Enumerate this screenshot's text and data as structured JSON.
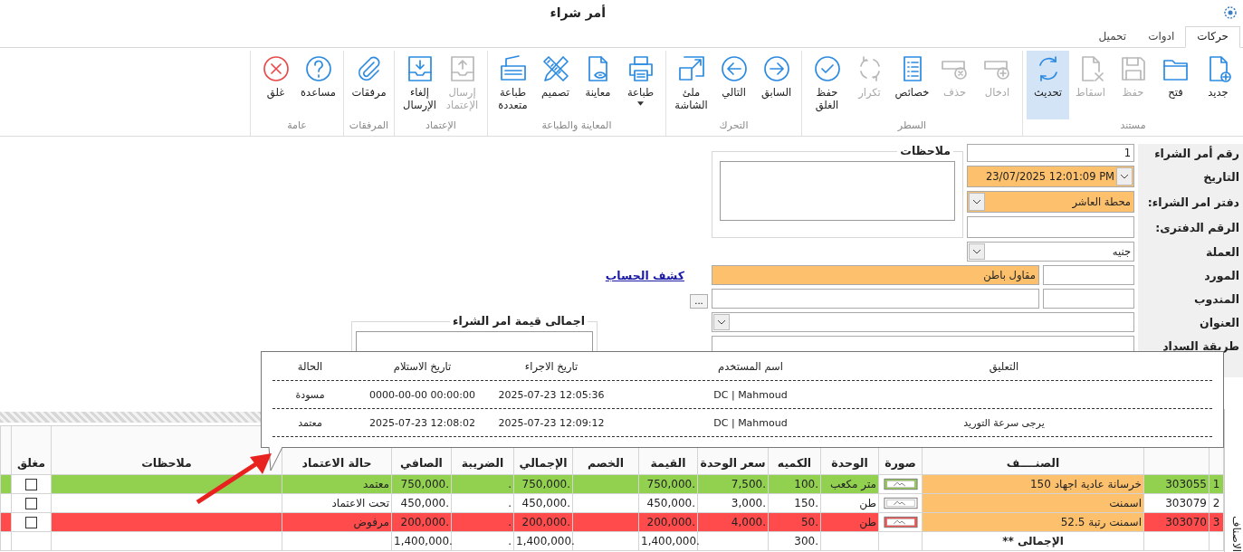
{
  "window": {
    "title": "أمر شراء"
  },
  "tabs": [
    {
      "label": "حركات",
      "selected": true
    },
    {
      "label": "ادوات",
      "selected": false
    },
    {
      "label": "تحميل",
      "selected": false
    }
  ],
  "ribbon": [
    {
      "label": "مستند",
      "buttons": [
        {
          "label": "جديد",
          "disabled": false,
          "highlighted": false,
          "dropdown": false
        },
        {
          "label": "فتح",
          "disabled": false,
          "highlighted": false,
          "dropdown": false
        },
        {
          "label": "حفظ",
          "disabled": true,
          "highlighted": false,
          "dropdown": false
        },
        {
          "label": "اسقاط",
          "disabled": true,
          "highlighted": false,
          "dropdown": false
        },
        {
          "label": "تحديث",
          "disabled": false,
          "highlighted": true,
          "dropdown": false
        }
      ]
    },
    {
      "label": "السطر",
      "buttons": [
        {
          "label": "ادخال",
          "disabled": true,
          "highlighted": false,
          "dropdown": false
        },
        {
          "label": "حذف",
          "disabled": true,
          "highlighted": false,
          "dropdown": false
        },
        {
          "label": "خصائص",
          "disabled": false,
          "highlighted": false,
          "dropdown": false
        },
        {
          "label": "تكرار",
          "disabled": true,
          "highlighted": false,
          "dropdown": false
        },
        {
          "label": "حفظ الغلق",
          "disabled": false,
          "highlighted": false,
          "dropdown": false
        }
      ]
    },
    {
      "label": "التحرك",
      "buttons": [
        {
          "label": "السابق",
          "disabled": false,
          "highlighted": false,
          "dropdown": false
        },
        {
          "label": "التالي",
          "disabled": false,
          "highlighted": false,
          "dropdown": false
        },
        {
          "label": "ملئ الشاشة",
          "disabled": false,
          "highlighted": false,
          "dropdown": false
        }
      ]
    },
    {
      "label": "المعاينة والطباعة",
      "buttons": [
        {
          "label": "طباعة",
          "disabled": false,
          "highlighted": false,
          "dropdown": true
        },
        {
          "label": "معاينة",
          "disabled": false,
          "highlighted": false,
          "dropdown": false
        },
        {
          "label": "تصميم",
          "disabled": false,
          "highlighted": false,
          "dropdown": false
        },
        {
          "label": "طباعة متعددة",
          "disabled": false,
          "highlighted": false,
          "dropdown": false
        }
      ]
    },
    {
      "label": "الإعتماد",
      "buttons": [
        {
          "label": "إرسال الإعتماد",
          "disabled": true,
          "highlighted": false,
          "dropdown": false
        },
        {
          "label": "إلغاء الإرسال",
          "disabled": false,
          "highlighted": false,
          "dropdown": false
        }
      ]
    },
    {
      "label": "المرفقات",
      "buttons": [
        {
          "label": "مرفقات",
          "disabled": false,
          "highlighted": false,
          "dropdown": false
        }
      ]
    },
    {
      "label": "عامة",
      "buttons": [
        {
          "label": "مساعدة",
          "disabled": false,
          "highlighted": false,
          "dropdown": false
        },
        {
          "label": "غلق",
          "disabled": false,
          "highlighted": false,
          "dropdown": false
        }
      ]
    }
  ],
  "form": {
    "fields": [
      {
        "label": "رقم أمر الشراء",
        "kind": "text",
        "value": "1",
        "required": false
      },
      {
        "label": "التاريخ",
        "kind": "date",
        "value": "23/07/2025 12:01:09 PM",
        "required": true
      },
      {
        "label": "دفتر امر الشراء:",
        "kind": "combo",
        "value": "محطة العاشر",
        "required": true
      },
      {
        "label": "الرقم الدفترى:",
        "kind": "text",
        "required": false
      },
      {
        "label": "العملة",
        "kind": "combo",
        "value": "جنيه",
        "required": false
      },
      {
        "label": "المورد",
        "kind": "pair",
        "value": "مقاول باطن",
        "required": true
      },
      {
        "label": "المندوب",
        "kind": "pair",
        "required": false
      },
      {
        "label": "العنوان",
        "kind": "combo",
        "required": false
      },
      {
        "label": "طريقة السداد",
        "kind": "text",
        "required": false
      }
    ],
    "notes": {
      "title": "ملاحظات"
    },
    "account_link": "كشف الحساب",
    "browse_button": "...",
    "totals_group": {
      "title": "اجمالى قيمة امر الشراء"
    }
  },
  "history_popup": {
    "columns": [
      "التعليق",
      "اسم المستخدم",
      "تاريخ الاجراء",
      "تاريخ الاستلام",
      "الحالة"
    ],
    "rows": [
      {
        "user": "DC | Mahmoud",
        "action_date": "2025-07-23 12:05:36",
        "receive_date": "0000-00-00 00:00:00",
        "status": "مسودة"
      },
      {
        "comment": "يرجى سرعة التوريد",
        "user": "DC | Mahmoud",
        "action_date": "2025-07-23 12:09:12",
        "receive_date": "2025-07-23 12:08:02",
        "status": "معتمد"
      }
    ]
  },
  "items_tab": "الاصناف",
  "table": {
    "columns": [
      "الصنــــف",
      "صورة",
      "الوحدة",
      "الكميه",
      "سعر الوحدة",
      "القيمة",
      "الخصم",
      "الإجمالي",
      "الضريبة",
      "الصافي",
      "حالة الاعتماد",
      "ملاحظات",
      "مغلق"
    ],
    "rows": [
      {
        "num": "1",
        "code": "303055",
        "item": "خرسانة عادية اجهاد 150",
        "unit": "متر مكعب",
        "qty": "100.",
        "price": "7,500.",
        "value": "750,000.",
        "total": "750,000.",
        "tax": ".",
        "net": "750,000.",
        "status": "معتمد",
        "closed": false,
        "color": "#92d050"
      },
      {
        "num": "2",
        "code": "303079",
        "item": "اسمنت",
        "unit": "طن",
        "qty": "150.",
        "price": "3,000.",
        "value": "450,000.",
        "total": "450,000.",
        "tax": ".",
        "net": "450,000.",
        "status": "تحت الاعتماد",
        "closed": false,
        "color": "#ffffff"
      },
      {
        "num": "3",
        "code": "303070",
        "item": "اسمنت رتبة 52.5",
        "unit": "طن",
        "qty": "50.",
        "price": "4,000.",
        "value": "200,000.",
        "total": "200,000.",
        "tax": ".",
        "net": "200,000.",
        "status": "مرفوض",
        "closed": false,
        "color": "#ff4b4b"
      }
    ],
    "totals": {
      "label": "الإجمالى **",
      "qty": "300.",
      "value": "1,400,000.",
      "total": "1,400,000.",
      "tax": ".",
      "net": "1,400,000."
    }
  }
}
